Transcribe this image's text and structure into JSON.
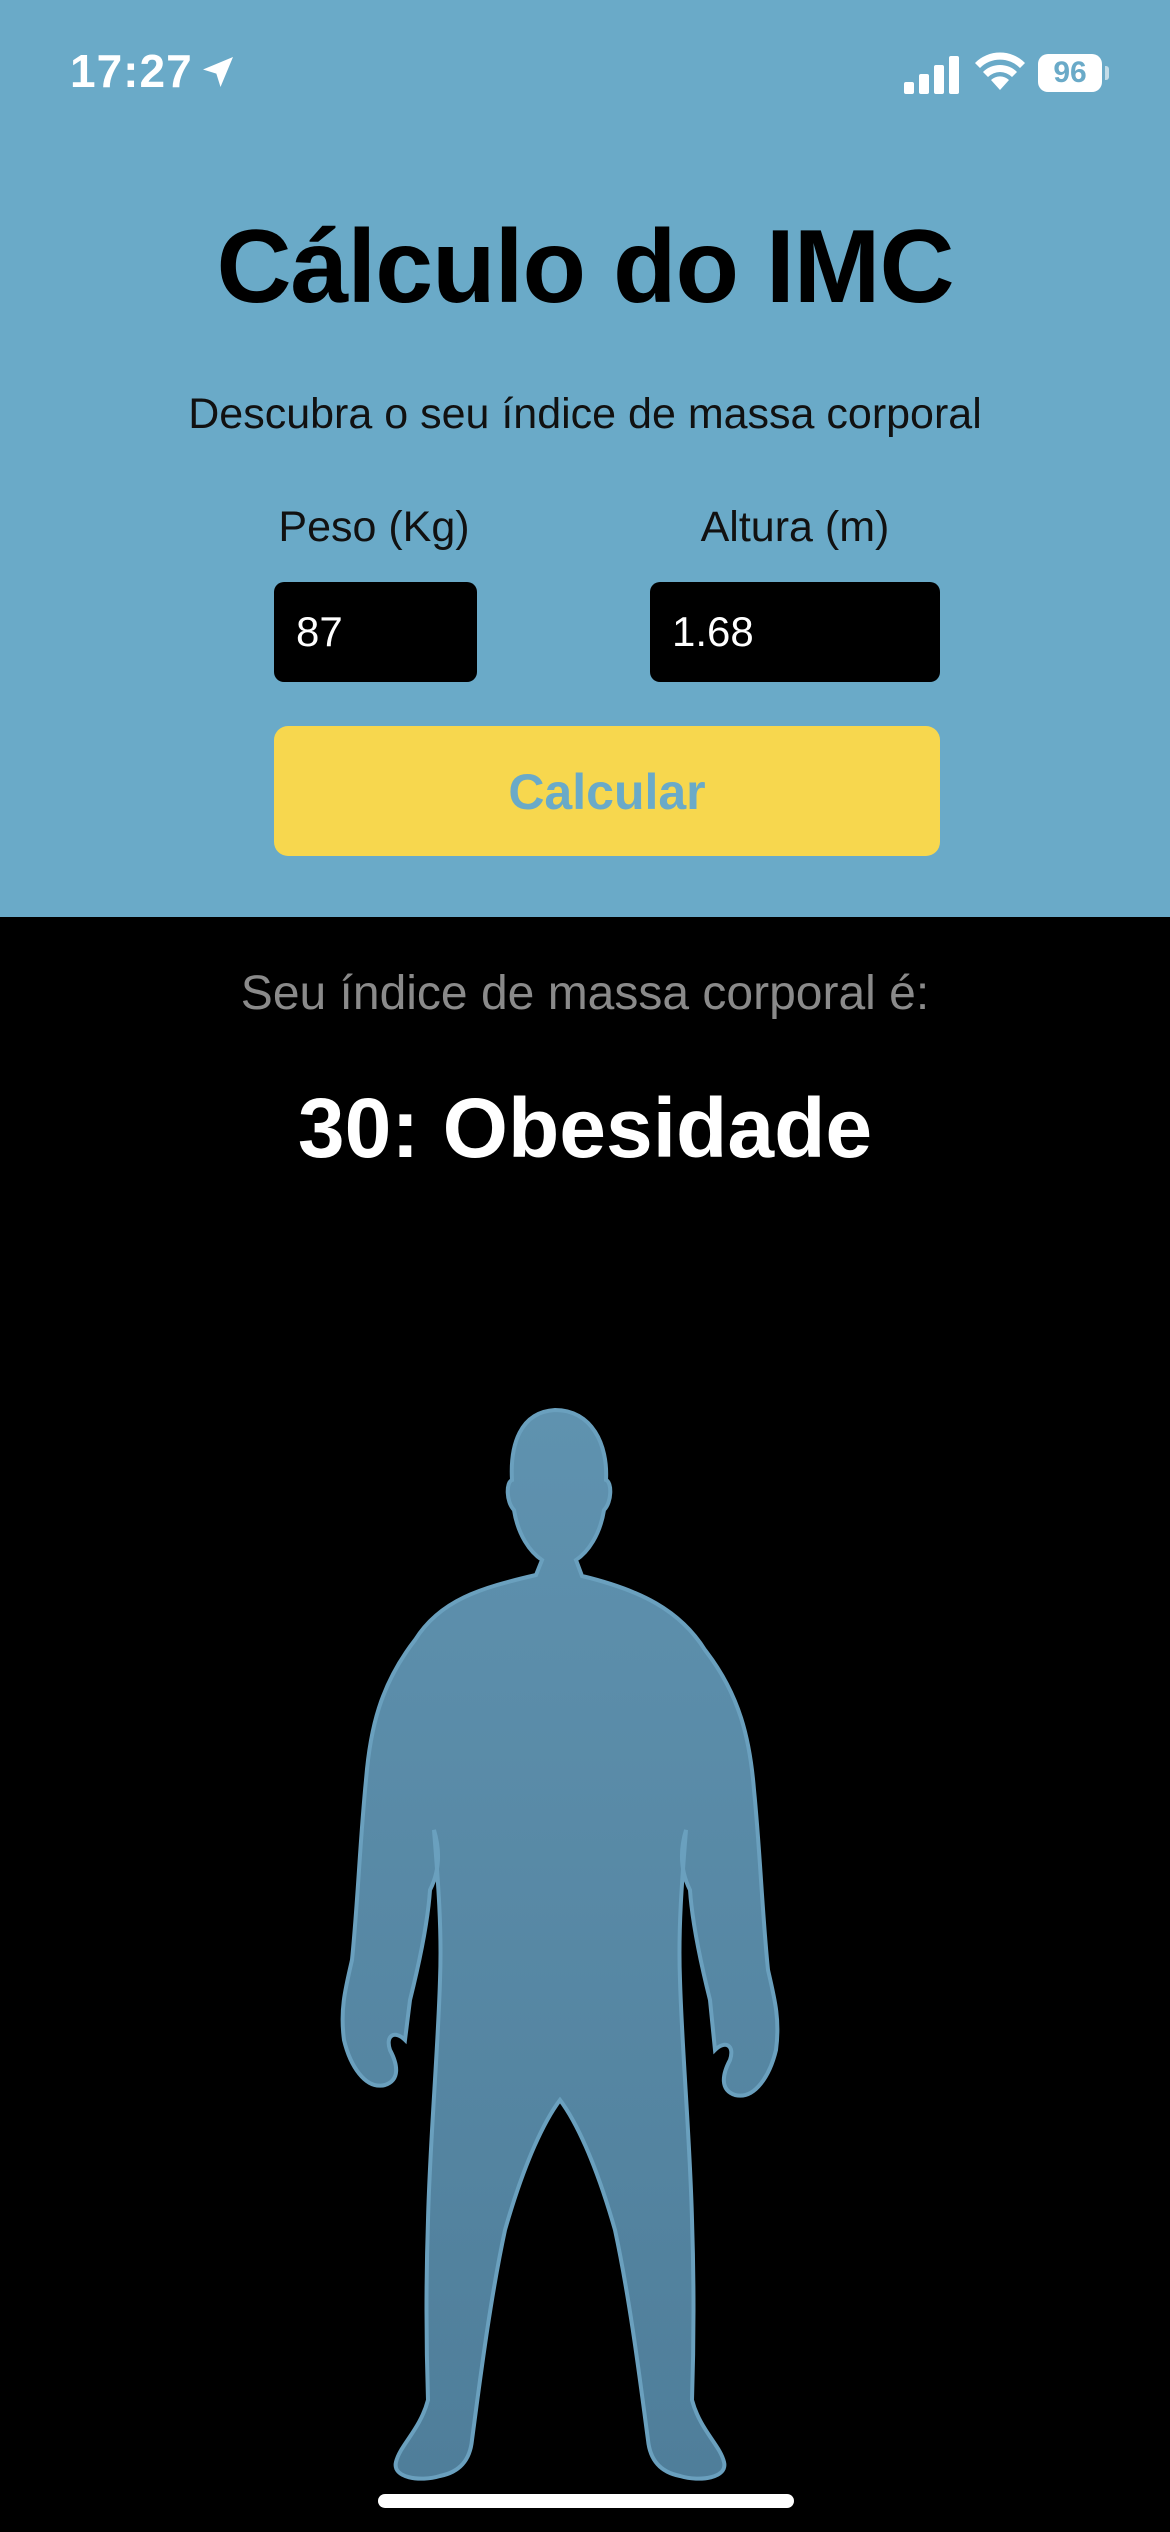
{
  "status_bar": {
    "time": "17:27",
    "battery": "96",
    "icons": [
      "location-arrow-icon",
      "cellular-signal-icon",
      "wifi-icon",
      "battery-icon"
    ]
  },
  "header": {
    "title": "Cálculo do IMC",
    "subtitle": "Descubra o seu índice de massa corporal"
  },
  "form": {
    "weight_label": "Peso (Kg)",
    "weight_value": "87",
    "height_label": "Altura (m)",
    "height_value": "1.68",
    "button_label": "Calcular"
  },
  "result": {
    "label": "Seu índice de massa corporal é:",
    "value": "30: Obesidade",
    "illustration": "obese-body-silhouette"
  },
  "colors": {
    "header_bg": "#6AAAC8",
    "button_bg": "#F7D74E",
    "button_text": "#6AAAC8",
    "result_bg": "#000000",
    "silhouette": "#5B8DAA"
  }
}
